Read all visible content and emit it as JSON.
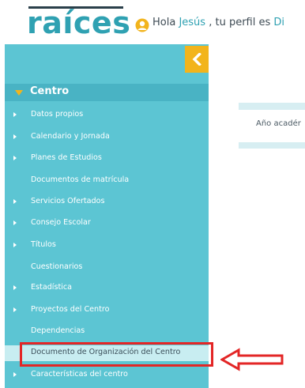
{
  "header": {
    "logo": "raíces",
    "greeting_prefix": "Hola ",
    "user_name": "Jesús",
    "greeting_suffix": " , tu perfil es ",
    "profile_partial": "Di"
  },
  "sidebar": {
    "section_title": "Centro",
    "items": [
      {
        "label": "Datos propios",
        "bullet": true
      },
      {
        "label": "Calendario y Jornada",
        "bullet": true
      },
      {
        "label": "Planes de Estudios",
        "bullet": true
      },
      {
        "label": "Documentos de matrícula",
        "bullet": false
      },
      {
        "label": "Servicios Ofertados",
        "bullet": true
      },
      {
        "label": "Consejo Escolar",
        "bullet": true
      },
      {
        "label": "Títulos",
        "bullet": true
      },
      {
        "label": "Cuestionarios",
        "bullet": false
      },
      {
        "label": "Estadística",
        "bullet": true
      },
      {
        "label": "Proyectos del Centro",
        "bullet": true
      },
      {
        "label": "Dependencias",
        "bullet": false
      },
      {
        "label": "Documento de Organización del Centro",
        "bullet": false
      },
      {
        "label": "Características del centro",
        "bullet": true
      }
    ]
  },
  "main": {
    "year_label": "Año acadér"
  },
  "colors": {
    "sidebar": "#5cc5d3",
    "section_header": "#49b3c4",
    "accent": "#f2b41c",
    "highlight": "#c8edf1",
    "annotation": "#e32626"
  }
}
